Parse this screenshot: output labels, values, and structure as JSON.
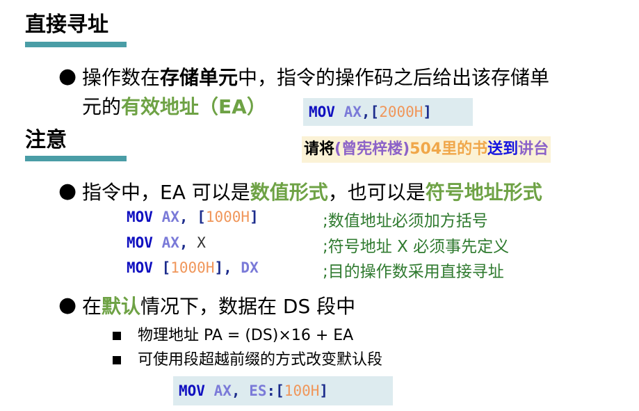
{
  "section1": {
    "title": "直接寻址"
  },
  "bullet1": {
    "pre": "操作数在",
    "bold1": "存储单元",
    "mid": "中，指令的操作码之后给出该存储单",
    "line2_pre": "元的",
    "bold2": "有效地址（EA）"
  },
  "code1": {
    "op": "MOV",
    "reg": "AX",
    "sep": ",",
    "lb": "[",
    "num": "2000H",
    "rb": "]"
  },
  "note": {
    "p1": "请将",
    "p2": "(曾宪梓楼)",
    "p3": "504里的书",
    "p4": "送到",
    "p5": "讲台"
  },
  "section2": {
    "title": "注意"
  },
  "bullet2": {
    "pre": "指令中，EA 可以是",
    "bold1": "数值形式",
    "mid": "，也可以是",
    "bold2": "符号地址形式"
  },
  "code_lines": [
    {
      "op": "MOV",
      "a": "AX",
      "sep": ", ",
      "lb": "[",
      "num": "1000H",
      "rb": "]",
      "comment": ";数值地址必须加方括号"
    },
    {
      "op": "MOV",
      "a": "AX",
      "sep": ", ",
      "sym": "X",
      "comment": ";符号地址 X 必须事先定义"
    },
    {
      "op": "MOV",
      "lb": "[",
      "num": "1000H",
      "rb": "]",
      "sep": ", ",
      "a": "DX",
      "comment": ";目的操作数采用直接寻址"
    }
  ],
  "bullet3": {
    "pre": "在",
    "bold": "默认",
    "post": "情况下，数据在 DS 段中",
    "sub1": "物理地址 PA = (DS)×16 + EA",
    "sub2": "可使用段超越前缀的方式改变默认段"
  },
  "code2": {
    "op": "MOV",
    "reg": "AX",
    "sep": ", ",
    "seg": "ES",
    "colon": ":",
    "lb": "[",
    "num": "100H",
    "rb": "]"
  }
}
